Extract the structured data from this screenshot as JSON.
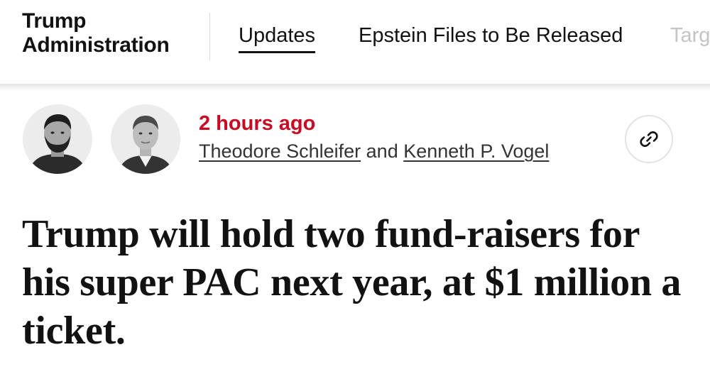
{
  "section": {
    "title_line1": "Trump",
    "title_line2": "Administration"
  },
  "nav": {
    "tabs": [
      {
        "label": "Updates",
        "active": true
      },
      {
        "label": "Epstein Files to Be Released",
        "active": false
      },
      {
        "label": "Targ",
        "active": false
      }
    ]
  },
  "article": {
    "timestamp": "2 hours ago",
    "authors": [
      "Theodore Schleifer",
      "Kenneth P. Vogel"
    ],
    "author_joiner": "and",
    "headline": "Trump will hold two fund-raisers for his super PAC next year, at $1 million a ticket."
  },
  "icons": {
    "share": "link-icon"
  },
  "colors": {
    "timestamp": "#c80a22",
    "text": "#121212",
    "byline": "#333333",
    "avatar_bg": "#ececec"
  }
}
